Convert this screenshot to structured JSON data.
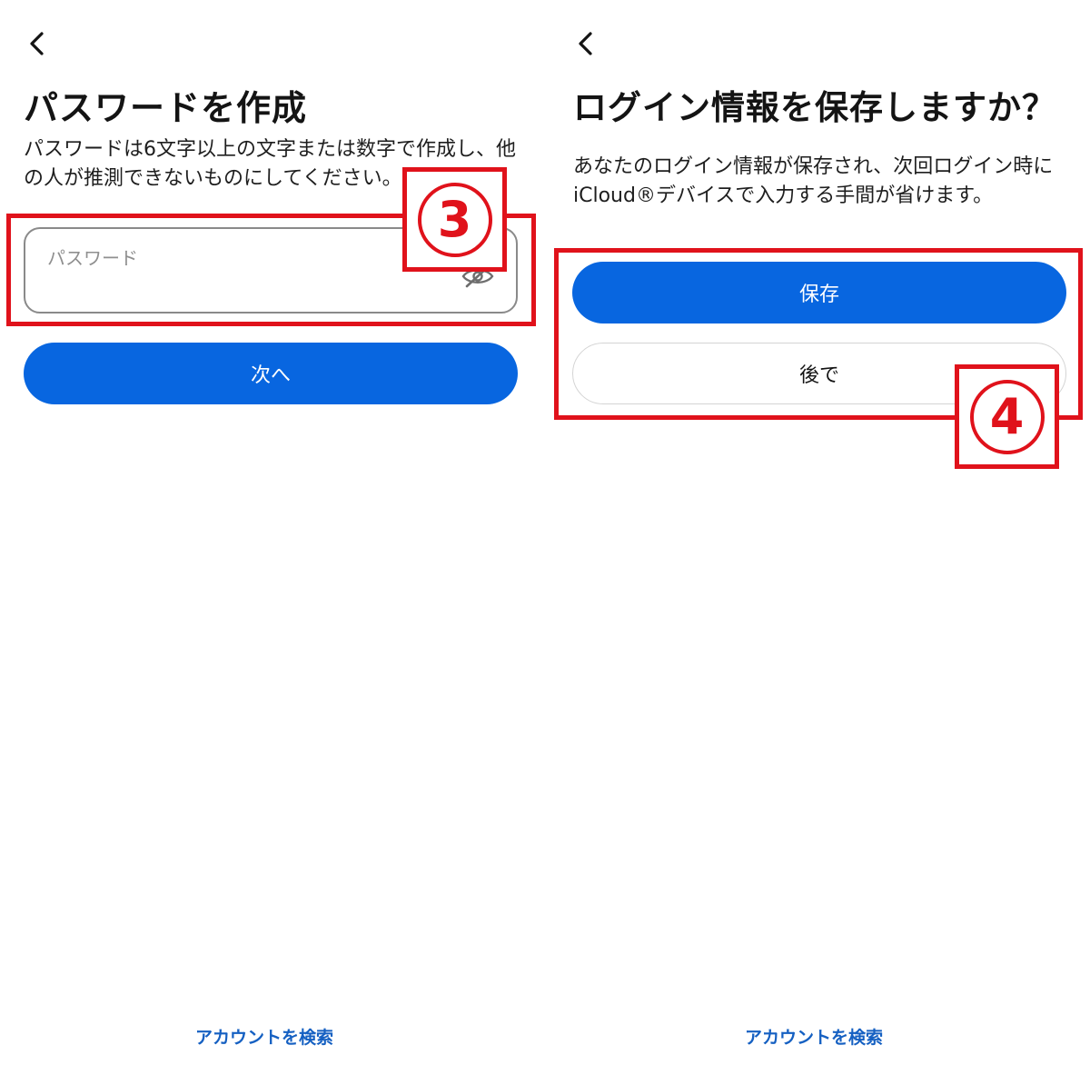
{
  "left_screen": {
    "title": "パスワードを作成",
    "description": "パスワードは6文字以上の文字または数字で作成し、他の人が推測できないものにしてください。",
    "password_placeholder": "パスワード",
    "next_label": "次へ",
    "footer_link": "アカウントを検索",
    "step_badge": "3"
  },
  "right_screen": {
    "title": "ログイン情報を保存しますか？",
    "description": "あなたのログイン情報が保存され、次回ログイン時にiCloud®デバイスで入力する手間が省けます。",
    "save_label": "保存",
    "later_label": "後で",
    "footer_link": "アカウントを検索",
    "step_badge": "4"
  },
  "icons": {
    "back": "chevron-left-icon",
    "password_visibility": "eye-off-icon"
  },
  "colors": {
    "primary_button": "#0866e0",
    "annotation": "#e0121b",
    "link": "#1560c2"
  }
}
